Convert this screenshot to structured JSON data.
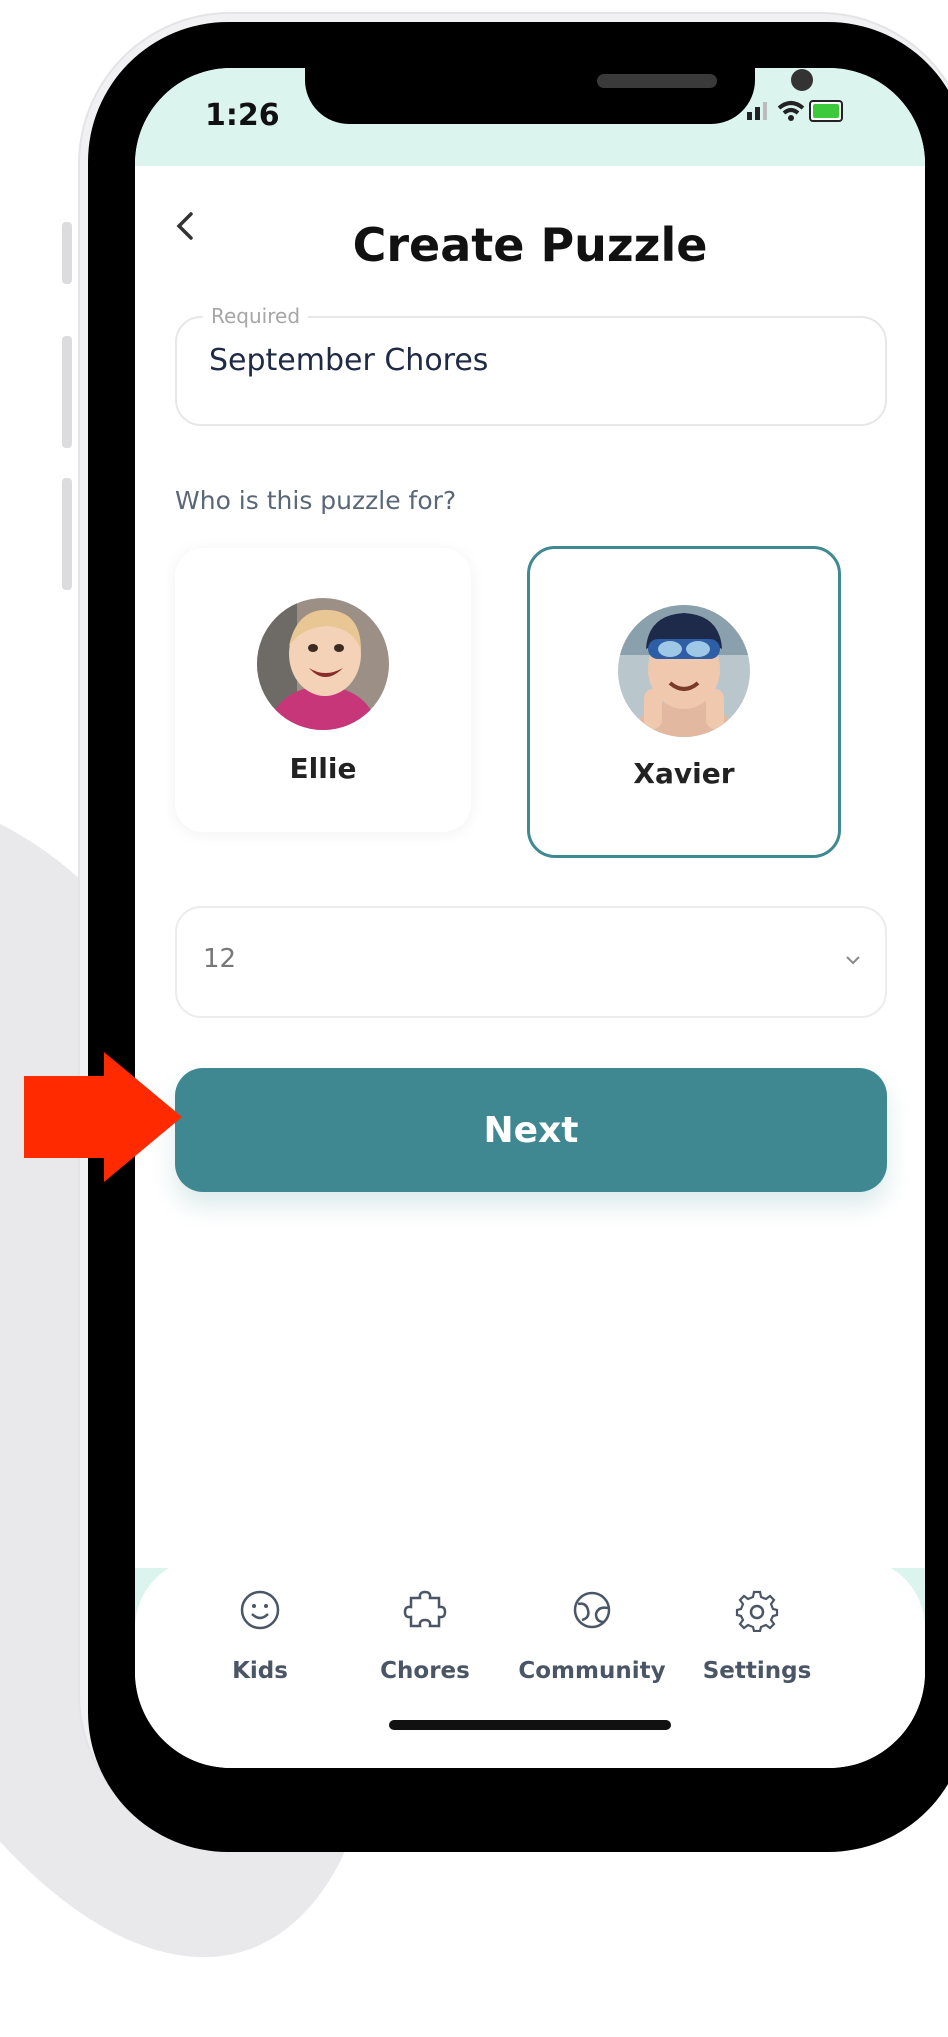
{
  "status": {
    "time": "1:26"
  },
  "header": {
    "title": "Create Puzzle"
  },
  "form": {
    "name_legend": "Required",
    "name_value": "September Chores",
    "question": "Who is this puzzle for?",
    "kids": [
      {
        "name": "Ellie",
        "selected": false
      },
      {
        "name": "Xavier",
        "selected": true
      }
    ],
    "pieces_value": "12",
    "next_label": "Next"
  },
  "tabs": [
    {
      "label": "Kids",
      "icon": "smiley-icon"
    },
    {
      "label": "Chores",
      "icon": "puzzle-piece-icon"
    },
    {
      "label": "Community",
      "icon": "globe-icon"
    },
    {
      "label": "Settings",
      "icon": "gear-icon"
    }
  ],
  "colors": {
    "accent": "#3f8892",
    "status_bar": "#dcf4ee",
    "arrow": "#ff2a00"
  }
}
